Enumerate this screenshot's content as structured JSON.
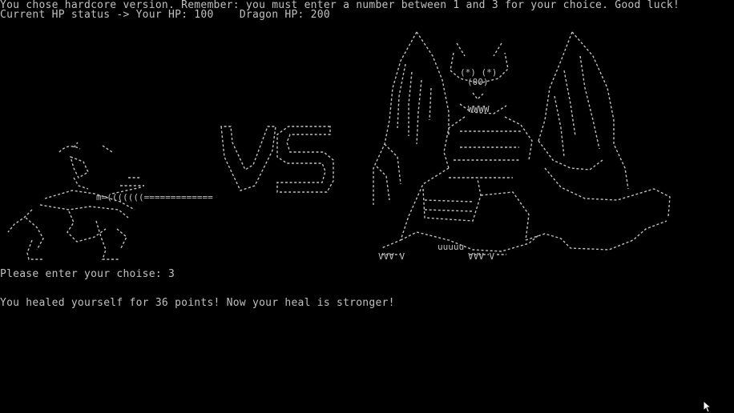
{
  "console": {
    "lines": {
      "intro": "You chose hardcore version. Remember: you must enter a number between 1 and 3 for your choice. Good luck!",
      "status": "Current HP status -> Your HP: 100    Dragon HP: 200",
      "prompt": "Please enter your choise: 3",
      "result": "You healed yourself for 36 points! Now your heal is stronger!"
    }
  },
  "art": {
    "versus": "VS",
    "lance": "m=(((((((=============",
    "dragon_eyes": "(*) (*)",
    "dragon_snout": "(00)",
    "dragon_teeth": "WWWW",
    "claws": "VVV V",
    "tail_feet": "uuuuu"
  },
  "colors": {
    "background": "#000000",
    "text": "#c0c0c0"
  },
  "icons": {
    "cursor": "mouse-pointer-icon"
  }
}
